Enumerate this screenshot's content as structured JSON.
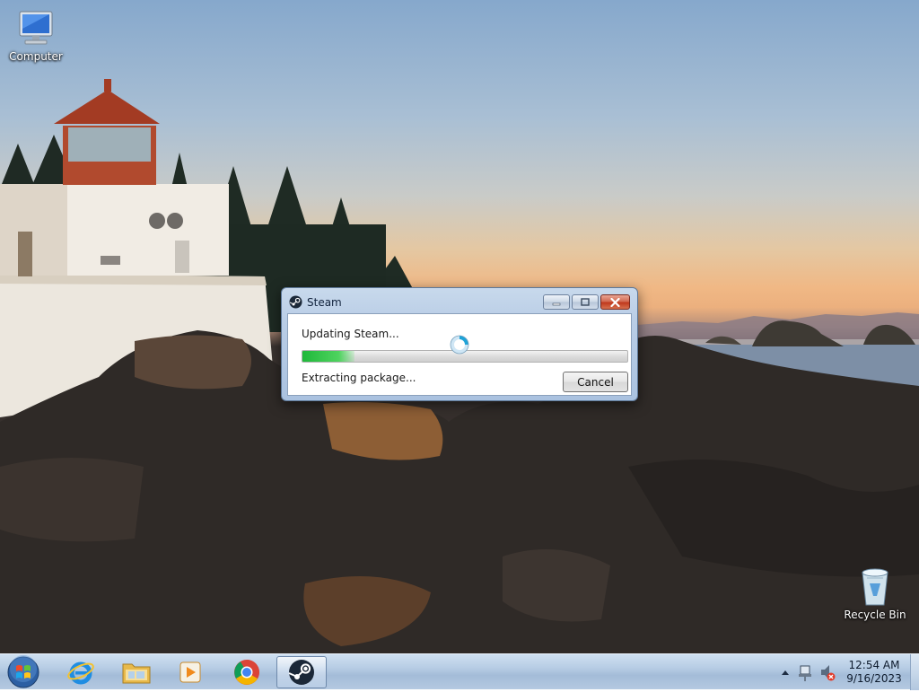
{
  "desktop": {
    "icons": [
      {
        "label": "Computer",
        "icon": "computer-icon"
      },
      {
        "label": "Recycle Bin",
        "icon": "recycle-bin-icon"
      }
    ]
  },
  "dialog": {
    "title": "Steam",
    "status": "Updating Steam...",
    "detail": "Extracting package...",
    "progress_fraction": 0.16,
    "cancel_label": "Cancel",
    "caption_buttons": [
      "minimize",
      "maximize",
      "close"
    ]
  },
  "taskbar": {
    "start_icon": "windows-start-orb-icon",
    "pinned": [
      {
        "name": "internet-explorer",
        "icon": "internet-explorer-icon"
      },
      {
        "name": "file-explorer",
        "icon": "folder-icon"
      },
      {
        "name": "media-player",
        "icon": "media-player-icon"
      },
      {
        "name": "chrome",
        "icon": "chrome-icon"
      },
      {
        "name": "steam",
        "icon": "steam-icon",
        "active": true
      }
    ],
    "tray_icons": [
      "show-hidden-icons-arrow",
      "network-icon",
      "volume-muted-icon"
    ],
    "clock": {
      "time": "12:54 AM",
      "date": "9/16/2023"
    }
  },
  "colors": {
    "progress": "#2ec244",
    "close_button": "#c8442a",
    "taskbar": "#b6cce4",
    "steam_blue": "#1b2838"
  }
}
